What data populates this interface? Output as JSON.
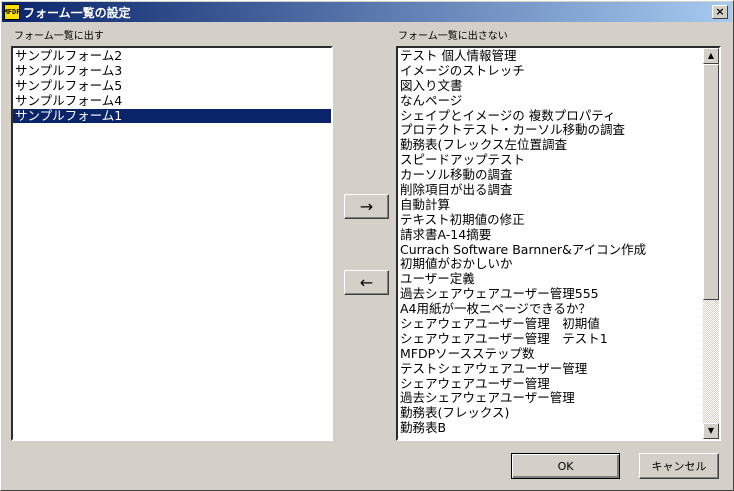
{
  "window": {
    "title": "フォーム一覧の設定",
    "icon_text": "MFDP",
    "icon_name": "app-icon",
    "close_symbol": "×"
  },
  "left_panel": {
    "label": "フォーム一覧に出す",
    "items": [
      {
        "label": "サンプルフォーム2",
        "selected": false
      },
      {
        "label": "サンプルフォーム3",
        "selected": false
      },
      {
        "label": "サンプルフォーム5",
        "selected": false
      },
      {
        "label": "サンプルフォーム4",
        "selected": false
      },
      {
        "label": "サンプルフォーム1",
        "selected": true
      }
    ]
  },
  "right_panel": {
    "label": "フォーム一覧に出さない",
    "items": [
      "テスト 個人情報管理",
      "イメージのストレッチ",
      "図入り文書",
      "なんページ",
      "シェイプとイメージの 複数プロパティ",
      "プロテクトテスト・カーソル移動の調査",
      "勤務表(フレックス左位置調査",
      "スピードアップテスト",
      "カーソル移動の調査",
      "削除項目が出る調査",
      "自動計算",
      "テキスト初期値の修正",
      "請求書A-14摘要",
      "Currach Software Barnner&アイコン作成",
      "初期値がおかしいか",
      "ユーザー定義",
      "過去シェアウェアユーザー管理555",
      "A4用紙が一枚ニページできるか？",
      "シェアウェアユーザー管理　初期値",
      "シェアウェアユーザー管理　テスト1",
      "MFDPソースステップ数",
      "テストシェアウェアユーザー管理",
      "シェアウェアユーザー管理",
      "過去シェアウェアユーザー管理",
      "勤務表(フレックス)",
      "勤務表B"
    ]
  },
  "buttons": {
    "move_right": "→",
    "move_left": "←",
    "ok": "OK",
    "cancel": "キャンセル"
  },
  "scrollbar": {
    "up_symbol": "▲",
    "down_symbol": "▼"
  }
}
